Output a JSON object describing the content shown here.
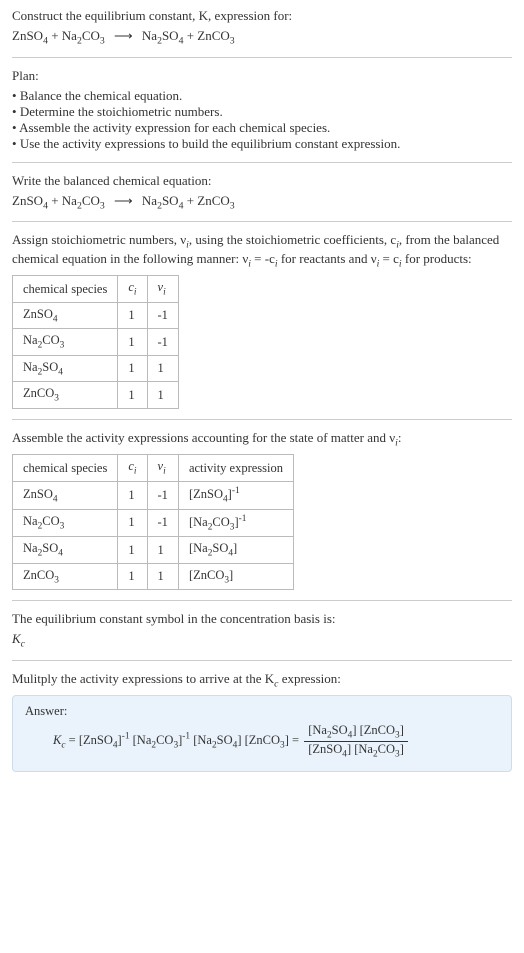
{
  "intro": {
    "line1": "Construct the equilibrium constant, K, expression for:",
    "equation_lhs1": "ZnSO",
    "equation_lhs1_sub": "4",
    "equation_lhs2": "Na",
    "equation_lhs2_sub1": "2",
    "equation_lhs2_mid": "CO",
    "equation_lhs2_sub2": "3",
    "equation_rhs1": "Na",
    "equation_rhs1_sub1": "2",
    "equation_rhs1_mid": "SO",
    "equation_rhs1_sub2": "4",
    "equation_rhs2": "ZnCO",
    "equation_rhs2_sub": "3",
    "arrow": "⟶"
  },
  "plan": {
    "heading": "Plan:",
    "items": [
      "Balance the chemical equation.",
      "Determine the stoichiometric numbers.",
      "Assemble the activity expression for each chemical species.",
      "Use the activity expressions to build the equilibrium constant expression."
    ]
  },
  "balanced": {
    "heading": "Write the balanced chemical equation:"
  },
  "assign": {
    "text_a": "Assign stoichiometric numbers, ν",
    "text_a_sub": "i",
    "text_b": ", using the stoichiometric coefficients, c",
    "text_b_sub": "i",
    "text_c": ", from the balanced chemical equation in the following manner: ν",
    "text_c_sub": "i",
    "text_d": " = -c",
    "text_d_sub": "i",
    "text_e": " for reactants and ν",
    "text_e_sub": "i",
    "text_f": " = c",
    "text_f_sub": "i",
    "text_g": " for products:"
  },
  "table1": {
    "headers": {
      "h1": "chemical species",
      "h2": "cᵢ",
      "h3": "νᵢ"
    },
    "rows": [
      {
        "sp_a": "ZnSO",
        "sp_sub": "4",
        "c": "1",
        "v": "-1"
      },
      {
        "sp_a": "Na",
        "sp_sub1": "2",
        "sp_b": "CO",
        "sp_sub2": "3",
        "c": "1",
        "v": "-1"
      },
      {
        "sp_a": "Na",
        "sp_sub1": "2",
        "sp_b": "SO",
        "sp_sub2": "4",
        "c": "1",
        "v": "1"
      },
      {
        "sp_a": "ZnCO",
        "sp_sub": "3",
        "c": "1",
        "v": "1"
      }
    ]
  },
  "assemble": {
    "text_a": "Assemble the activity expressions accounting for the state of matter and ν",
    "text_a_sub": "i",
    "text_b": ":"
  },
  "table2": {
    "headers": {
      "h1": "chemical species",
      "h2": "cᵢ",
      "h3": "νᵢ",
      "h4": "activity expression"
    },
    "rows": [
      {
        "sp_a": "ZnSO",
        "sp_sub": "4",
        "c": "1",
        "v": "-1",
        "act_a": "[ZnSO",
        "act_sub": "4",
        "act_b": "]",
        "act_sup": "-1"
      },
      {
        "sp_a": "Na",
        "sp_sub1": "2",
        "sp_b": "CO",
        "sp_sub2": "3",
        "c": "1",
        "v": "-1",
        "act_a": "[Na",
        "act_sub1": "2",
        "act_mid": "CO",
        "act_sub2": "3",
        "act_b": "]",
        "act_sup": "-1"
      },
      {
        "sp_a": "Na",
        "sp_sub1": "2",
        "sp_b": "SO",
        "sp_sub2": "4",
        "c": "1",
        "v": "1",
        "act_a": "[Na",
        "act_sub1": "2",
        "act_mid": "SO",
        "act_sub2": "4",
        "act_b": "]"
      },
      {
        "sp_a": "ZnCO",
        "sp_sub": "3",
        "c": "1",
        "v": "1",
        "act_a": "[ZnCO",
        "act_sub": "3",
        "act_b": "]"
      }
    ]
  },
  "concbasis": {
    "line1": "The equilibrium constant symbol in the concentration basis is:",
    "sym_a": "K",
    "sym_sub": "c"
  },
  "multiply": {
    "text_a": "Mulitply the activity expressions to arrive at the K",
    "text_a_sub": "c",
    "text_b": " expression:"
  },
  "answer": {
    "label": "Answer:",
    "lhs_a": "K",
    "lhs_sub": "c",
    "eq": " = ",
    "t1_a": "[ZnSO",
    "t1_sub": "4",
    "t1_b": "]",
    "t1_sup": "-1",
    "t2_a": "[Na",
    "t2_sub1": "2",
    "t2_mid": "CO",
    "t2_sub2": "3",
    "t2_b": "]",
    "t2_sup": "-1",
    "t3_a": "[Na",
    "t3_sub1": "2",
    "t3_mid": "SO",
    "t3_sub2": "4",
    "t3_b": "]",
    "t4_a": "[ZnCO",
    "t4_sub": "3",
    "t4_b": "]",
    "eq2": " = ",
    "num_a": "[Na",
    "num_sub1": "2",
    "num_mid": "SO",
    "num_sub2": "4",
    "num_b": "] [ZnCO",
    "num_sub3": "3",
    "num_c": "]",
    "den_a": "[ZnSO",
    "den_sub1": "4",
    "den_b": "] [Na",
    "den_sub2": "2",
    "den_mid": "CO",
    "den_sub3": "3",
    "den_c": "]"
  }
}
